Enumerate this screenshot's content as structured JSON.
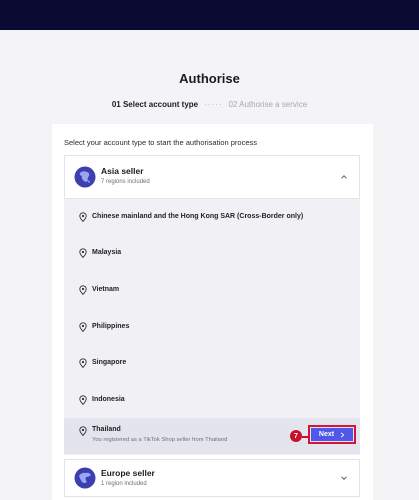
{
  "page": {
    "title": "Authorise",
    "steps": [
      {
        "label": "01 Select account type",
        "active": true
      },
      {
        "label": "02 Authorise a service",
        "active": false
      }
    ],
    "step_separator": "·····"
  },
  "panel": {
    "prompt": "Select your account type to start the authorisation process"
  },
  "groups": [
    {
      "name": "Asia seller",
      "count": "7 regions included",
      "expanded": true,
      "icon": "globe-asia-icon"
    },
    {
      "name": "Europe seller",
      "count": "1 region included",
      "expanded": false,
      "icon": "globe-europe-icon"
    }
  ],
  "regions": [
    {
      "name": "Chinese mainland and the Hong Kong SAR (Cross-Border only)"
    },
    {
      "name": "Malaysia"
    },
    {
      "name": "Vietnam"
    },
    {
      "name": "Philippines"
    },
    {
      "name": "Singapore"
    },
    {
      "name": "Indonesia"
    },
    {
      "name": "Thailand",
      "note": "You registered as a TikTok Shop seller from Thailand",
      "selected": true
    }
  ],
  "actions": {
    "next_label": "Next",
    "next_icon": "chevron-right-icon"
  },
  "annotation": {
    "step_number": "7"
  },
  "colors": {
    "topbar": "#0a0a33",
    "accent": "#4f58e8",
    "highlight": "#d0163b",
    "background": "#f4f4f6"
  }
}
